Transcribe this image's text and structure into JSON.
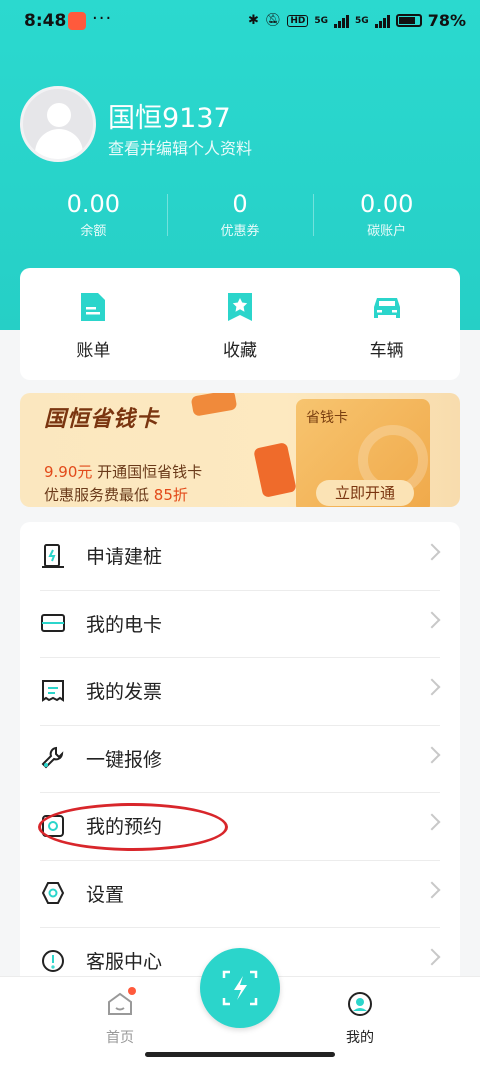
{
  "status_bar": {
    "time": "8:48",
    "dots": "···",
    "hd": "HD",
    "net1": "5G",
    "net2": "5G",
    "battery": "78%"
  },
  "profile": {
    "username": "国恒9137",
    "subtitle": "查看并编辑个人资料"
  },
  "stats": [
    {
      "value": "0.00",
      "label": "余额"
    },
    {
      "value": "0",
      "label": "优惠券"
    },
    {
      "value": "0.00",
      "label": "碳账户"
    }
  ],
  "quick_actions": [
    {
      "label": "账单",
      "icon": "bill-icon"
    },
    {
      "label": "收藏",
      "icon": "bookmark-icon"
    },
    {
      "label": "车辆",
      "icon": "car-icon"
    }
  ],
  "promo": {
    "title": "国恒省钱卡",
    "card_label": "省钱卡",
    "line1_price": "9.90元",
    "line1_text": " 开通国恒省钱卡",
    "line2_text": "优惠服务费最低 ",
    "line2_discount": "85折",
    "button": "立即开通"
  },
  "menu": [
    {
      "label": "申请建桩",
      "icon": "charger-pile-icon"
    },
    {
      "label": "我的电卡",
      "icon": "card-icon"
    },
    {
      "label": "我的发票",
      "icon": "invoice-icon"
    },
    {
      "label": "一键报修",
      "icon": "wrench-icon"
    },
    {
      "label": "我的预约",
      "icon": "reservation-icon"
    },
    {
      "label": "设置",
      "icon": "settings-icon"
    },
    {
      "label": "客服中心",
      "icon": "service-icon"
    }
  ],
  "tabbar": {
    "home": "首页",
    "mine": "我的"
  },
  "colors": {
    "accent": "#2bd5cb",
    "annotation": "#d8262b"
  }
}
